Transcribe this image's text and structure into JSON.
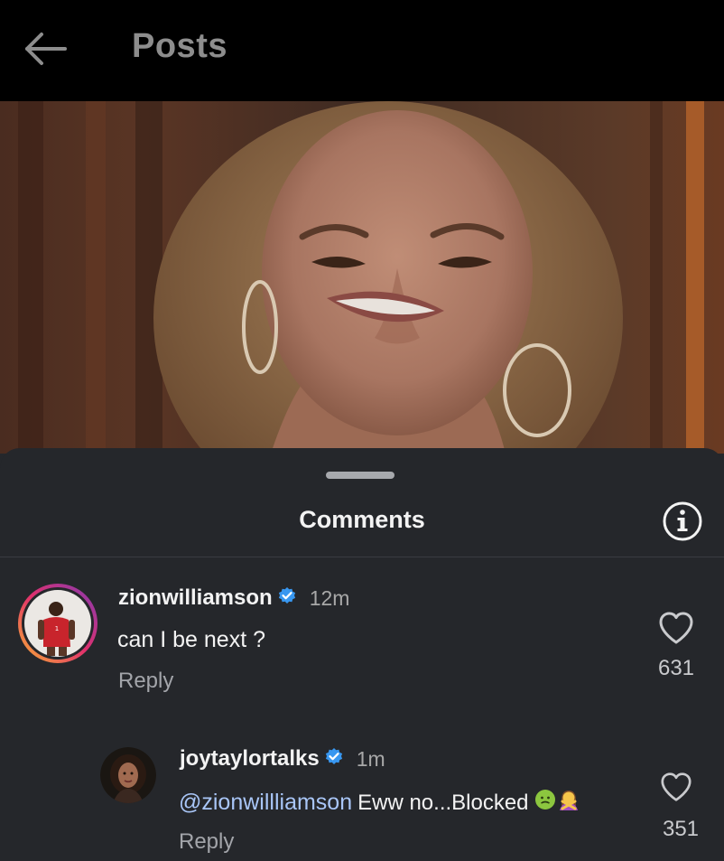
{
  "topbar": {
    "title": "Posts",
    "back_icon": "arrow-left-icon"
  },
  "post": {
    "media_description_icon": "video-frame"
  },
  "comments_sheet": {
    "title": "Comments",
    "info_icon": "info-circle-icon",
    "comments": [
      {
        "username": "zionwilliamson",
        "verified": true,
        "time": "12m",
        "text": "can I be next ?",
        "reply_label": "Reply",
        "likes": "631"
      },
      {
        "username": "joytaylortalks",
        "verified": true,
        "time": "1m",
        "mention": "@zionwillliamson",
        "text": "Eww no...Blocked",
        "reply_label": "Reply",
        "likes": "351"
      }
    ]
  },
  "colors": {
    "background": "#25272b",
    "topbar": "#000000",
    "verified_blue": "#3897f0",
    "mention_blue": "#a9c6f7"
  }
}
